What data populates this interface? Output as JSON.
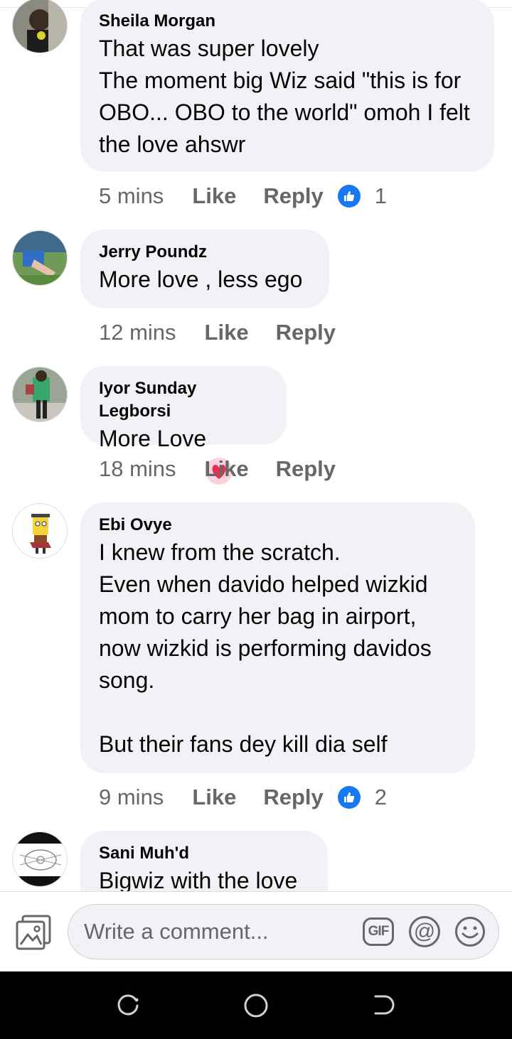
{
  "comments": [
    {
      "name": "Sheila Morgan",
      "text": "That was super lovely\nThe moment big Wiz said \"this is for OBO... OBO to the world\" omoh I felt the love ahswr",
      "time": "5 mins",
      "like": "Like",
      "reply": "Reply",
      "reactions": "1"
    },
    {
      "name": "Jerry Poundz",
      "text": "More love , less ego",
      "time": "12 mins",
      "like": "Like",
      "reply": "Reply",
      "reactions": ""
    },
    {
      "name": "Iyor Sunday Legborsi",
      "text": "More Love",
      "time": "18 mins",
      "like": "Like",
      "reply": "Reply",
      "reactions": ""
    },
    {
      "name": "Ebi Ovye",
      "text": "I  knew from the scratch.\nEven when davido helped wizkid mom to carry her bag in airport, now wizkid is performing davidos song.\n\nBut their fans dey kill dia self",
      "time": "9 mins",
      "like": "Like",
      "reply": "Reply",
      "reactions": "2"
    },
    {
      "name": "Sani Muh'd",
      "text": "Bigwiz with the love",
      "time": "",
      "like": "",
      "reply": "",
      "reactions": ""
    }
  ],
  "composer": {
    "placeholder": "Write a comment...",
    "gif_label": "GIF",
    "at_label": "@"
  },
  "icons": {
    "reaction": "like-thumb-icon",
    "heart": "heart-icon",
    "photo": "photo-icon",
    "emoji": "emoji-icon"
  },
  "colors": {
    "accent": "#1877f2",
    "bubble": "#f0f2f5",
    "meta": "#65676b"
  }
}
